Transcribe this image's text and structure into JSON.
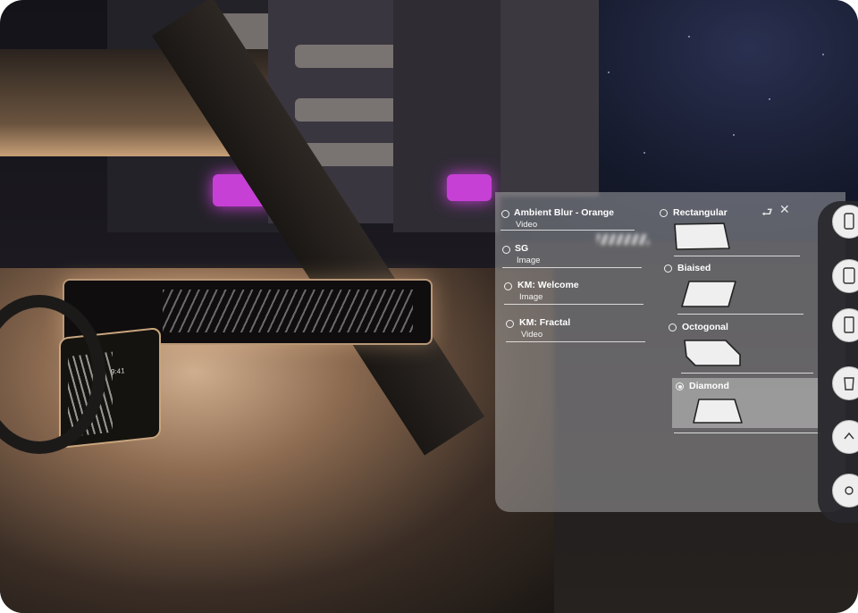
{
  "panel": {
    "content_list": [
      {
        "title": "Ambient Blur - Orange",
        "type": "Video",
        "selected": false
      },
      {
        "title": "SG",
        "type": "Image",
        "selected": false
      },
      {
        "title": "KM: Welcome",
        "type": "Image",
        "selected": false
      },
      {
        "title": "KM: Fractal",
        "type": "Video",
        "selected": false
      }
    ],
    "shapes": [
      {
        "label": "Rectangular",
        "icon": "rectangle-shape-icon",
        "selected": false
      },
      {
        "label": "Biaised",
        "icon": "parallelogram-shape-icon",
        "selected": false
      },
      {
        "label": "Octogonal",
        "icon": "octagon-shape-icon",
        "selected": false
      },
      {
        "label": "Diamond",
        "icon": "trapezoid-shape-icon",
        "selected": true
      }
    ],
    "top_icons": [
      "return-icon",
      "close-icon"
    ]
  },
  "side_rail": {
    "buttons": [
      "phone-icon",
      "tablet-icon",
      "screen-icon",
      "cup-icon",
      "chevron-icon",
      "extra-icon"
    ]
  },
  "center_screen": {
    "clock": "9:41"
  },
  "colors": {
    "neon": "#c640d6",
    "panel": "#c8c8c8",
    "accent_light": "#ffffff"
  }
}
